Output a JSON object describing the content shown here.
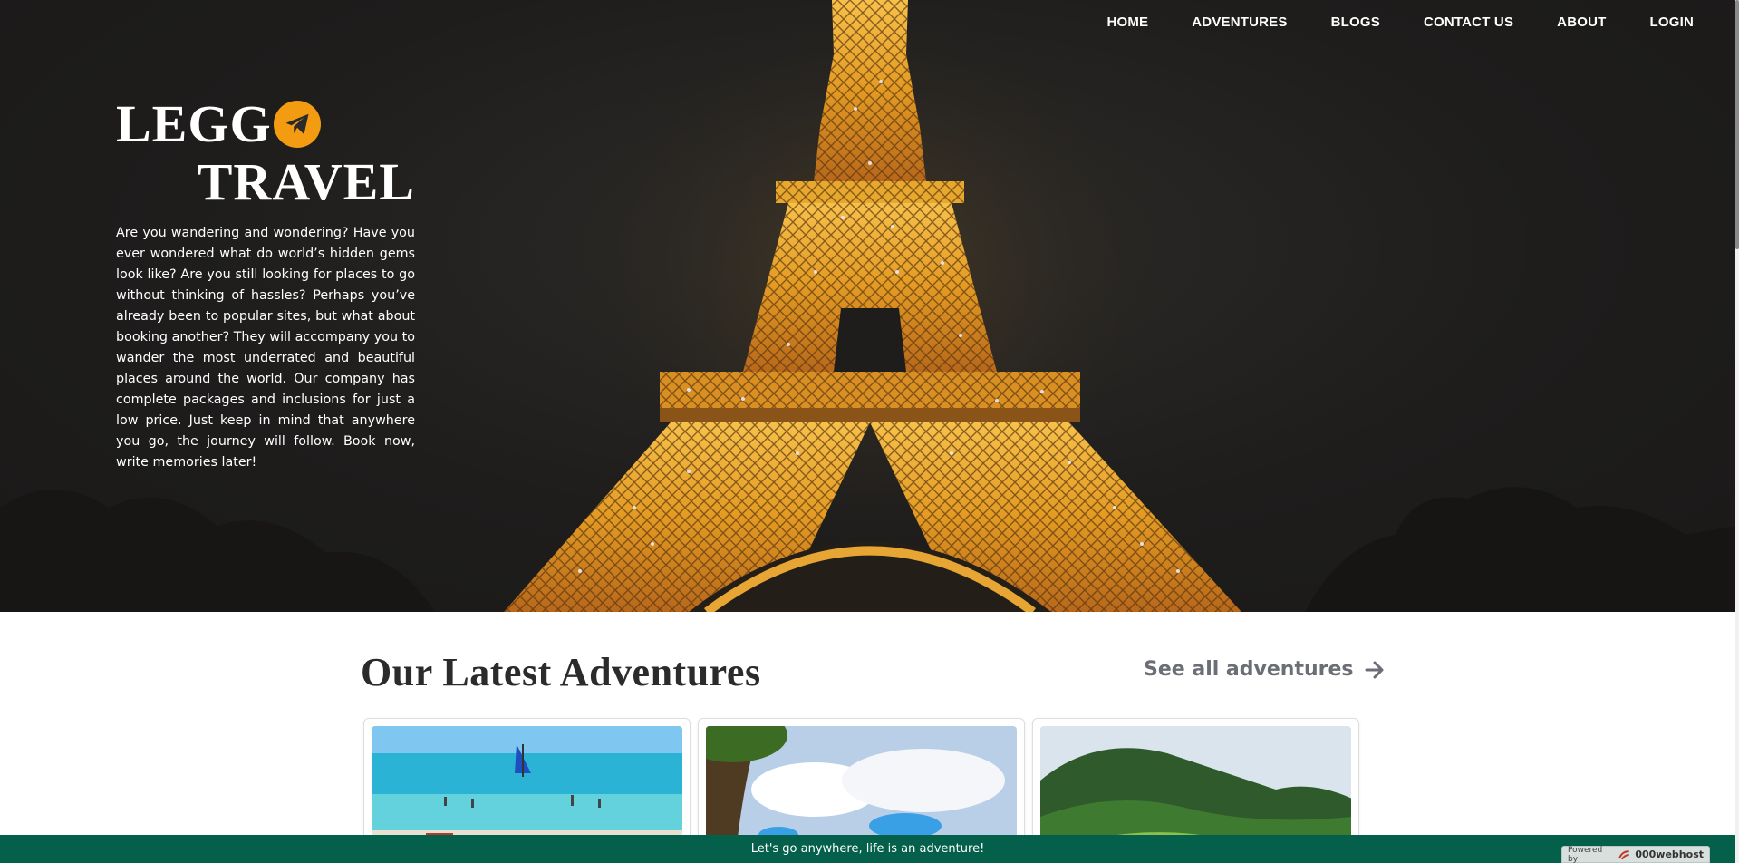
{
  "nav": {
    "items": [
      {
        "label": "HOME"
      },
      {
        "label": "ADVENTURES"
      },
      {
        "label": "BLOGS"
      },
      {
        "label": "CONTACT US"
      },
      {
        "label": "ABOUT"
      },
      {
        "label": "LOGIN"
      }
    ]
  },
  "brand": {
    "line1": "LEGG",
    "line2": "TRAVEL",
    "logo_icon": "paper-plane-icon"
  },
  "hero": {
    "text": "Are you wandering and wondering? Have you ever wondered what do world’s hidden gems look like? Are you still looking for places to go without thinking of hassles? Perhaps you’ve already been to popular sites, but what about booking another? They will accompany you to wander the most underrated and beautiful places around the world. Our company has complete packages and inclusions for just a low price. Just keep in mind that anywhere you go, the journey will follow. Book now, write memories later!"
  },
  "latest": {
    "title": "Our Latest Adventures",
    "see_all_label": "See all adventures",
    "see_all_icon": "arrow-right-icon",
    "cards": [
      {
        "image": "beach-photo"
      },
      {
        "image": "tree-clouds-photo"
      },
      {
        "image": "rice-terraces-photo"
      }
    ]
  },
  "footer": {
    "tagline": "Let's go anywhere, life is an adventure!",
    "powered_by": "Powered by",
    "host_name": "000webhost"
  },
  "colors": {
    "accent": "#f39c12",
    "footer_bar": "#04604a",
    "hero_bg": "#1e1d1c",
    "see_all": "#6b6e75"
  }
}
